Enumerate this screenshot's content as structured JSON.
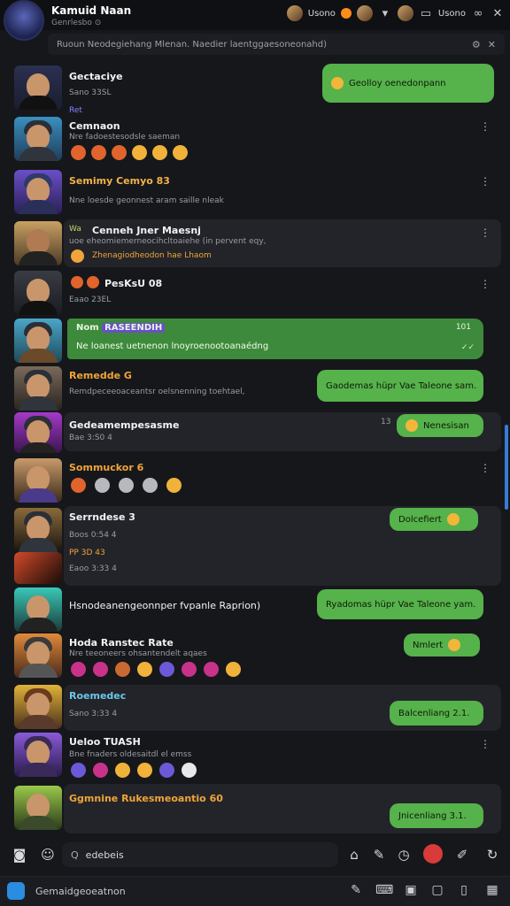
{
  "header": {
    "title": "Kamuid Naan",
    "subtitle": "Genrlesbo ⊙",
    "right_label_1": "Usono",
    "right_label_2": "Usono",
    "close": "✕"
  },
  "search": {
    "placeholder": "Ruoun Neodegiehang Mlenan. Naedier laentggaesoneonahd)"
  },
  "chats": [
    {
      "name": "Gectaciye",
      "sub": "Sano 33SL",
      "bubble": "Geolloy oenedonpann",
      "tag": "Ret"
    },
    {
      "name": "Cemnaon",
      "sub": "Nre fadoestesodsle saeman"
    },
    {
      "name": "Semimy Cemyo 83",
      "sub": "Nne loesde geonnest aram saille nleak"
    },
    {
      "name": "Cenneh Jner Maesnj",
      "sub": "uoe eheomiemerneocihcltoaiehe (in pervent eqy,",
      "prefix": "Wa",
      "line3": "Zhenagiodheodon hae Lhaom"
    },
    {
      "name": "PesKsU 08",
      "sub": "Eaao 23EL"
    },
    {
      "name": "RASEENDIH",
      "prefix": "Nom",
      "sub": "Ne loanest uetnenon lnoyroenootoanaédng",
      "time": "101"
    },
    {
      "name": "Remedde G",
      "sub": "Remdpeceeoaceantsr oelsnenning toehtael,",
      "bubble": "Gaodemas hüpr Vae Taleone sam."
    },
    {
      "name": "Gedeamempesasme",
      "sub": "Bae 3:S0 4",
      "bubble": "Nenesisan",
      "tag": "13"
    },
    {
      "name": "Sommuckor 6",
      "sub": ""
    },
    {
      "name": "Serrndese 3",
      "sub": "Boos 0:54 4",
      "sub2": "Eaoo 3:33 4",
      "line3": "PP 3D 43",
      "bubble": "Dolcefiert"
    },
    {
      "name": "Hsnodeanengeonnper fvpanle Raprion)",
      "sub": "",
      "bubble": "Ryadomas hüpr Vae Taleone yam."
    },
    {
      "name": "Hoda Ranstec Rate",
      "sub": "Nre teeoneers ohsantendelt aqaes",
      "bubble": "Nmlert"
    },
    {
      "name": "Roemedec",
      "sub": "Sano 3:33 4",
      "bubble": "Balcenliang 2.1."
    },
    {
      "name": "Ueloo TUASH",
      "sub": "Bne fnaders oldesaitdl el emss"
    },
    {
      "name": "Ggmnine Rukesmeoantio 60",
      "sub": "",
      "bubble": "Jnicenliang 3.1."
    }
  ],
  "composer": {
    "search_label": "Q",
    "value": "edebeis"
  },
  "bottombar": {
    "label": "Gemaidgeoeatnon"
  },
  "colors": {
    "bubble_green": "#56b24a",
    "bg": "#16171b",
    "card": "#232429",
    "accent": "#2b8ce0"
  },
  "icons": [
    "camera-icon",
    "emoji-icon",
    "home-icon",
    "pen-icon",
    "clock-icon",
    "record-icon",
    "edit-icon",
    "refresh-icon",
    "compose-icon",
    "keyboard-icon",
    "sticker-icon",
    "lock-icon",
    "square-icon",
    "more-icon",
    "close-icon"
  ]
}
